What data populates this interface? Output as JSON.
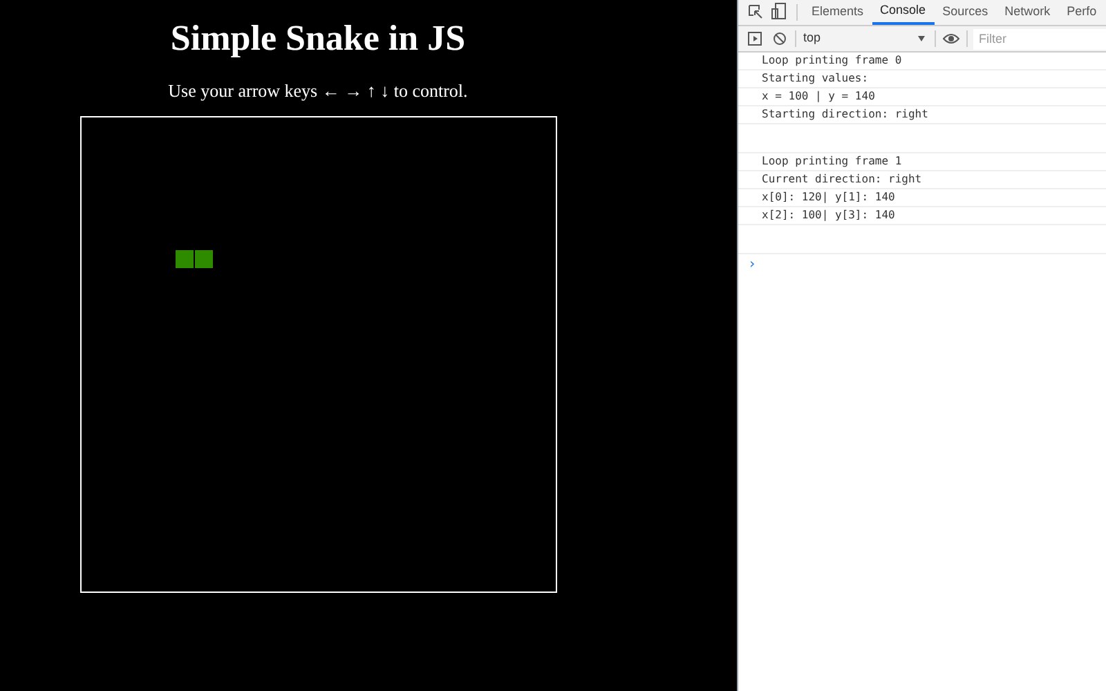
{
  "page": {
    "title": "Simple Snake in JS",
    "instructions": "Use your arrow keys ← → ↑ ↓ to control."
  },
  "devtools": {
    "tabs": [
      {
        "label": "Elements",
        "selected": false
      },
      {
        "label": "Console",
        "selected": true
      },
      {
        "label": "Sources",
        "selected": false
      },
      {
        "label": "Network",
        "selected": false
      },
      {
        "label": "Perfo",
        "selected": false
      }
    ],
    "context": "top",
    "filter": {
      "placeholder": "Filter"
    },
    "console_groups": [
      [
        "Loop printing frame 0",
        "Starting values:",
        "x = 100 | y = 140",
        "Starting direction: right"
      ],
      [
        "Loop printing frame 1",
        "Current direction: right",
        "x[0]: 120| y[1]: 140",
        "x[2]: 100| y[3]: 140"
      ]
    ],
    "prompt": "›"
  }
}
